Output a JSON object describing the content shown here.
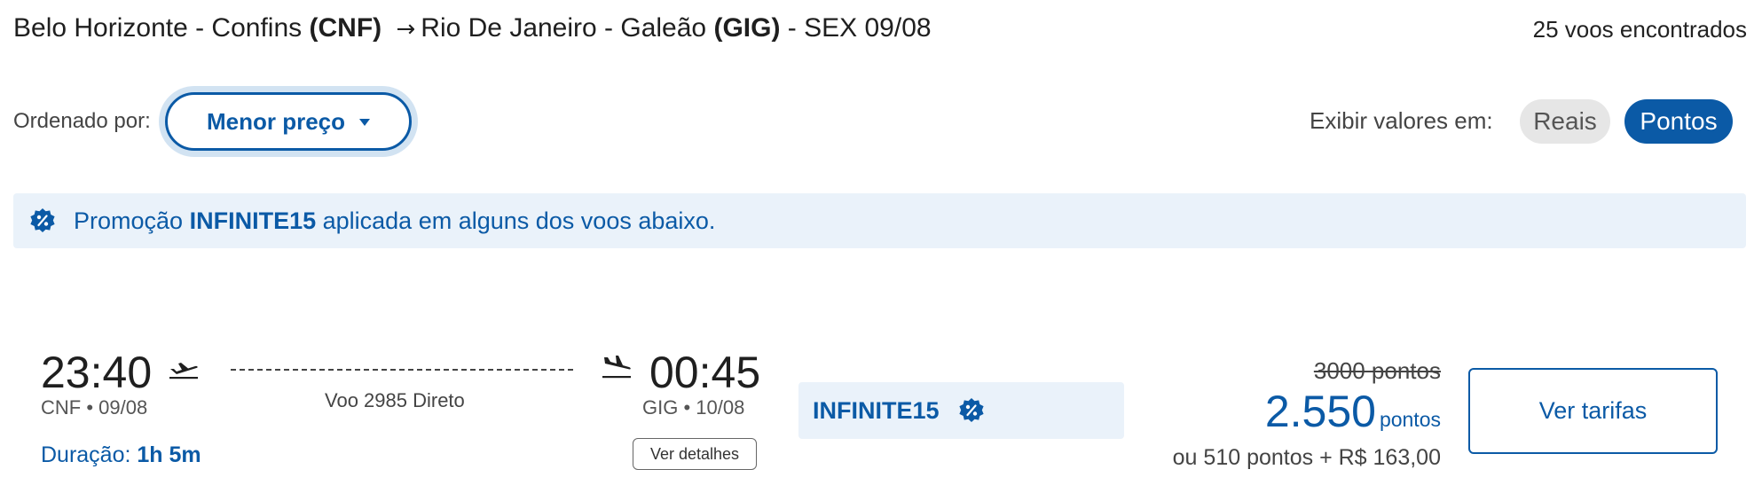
{
  "header": {
    "origin_city": "Belo Horizonte - Confins",
    "origin_code": "(CNF)",
    "arrow": "→",
    "destination_city": "Rio De Janeiro - Galeão",
    "destination_code": "(GIG)",
    "date": "- SEX 09/08",
    "results_count": "25 voos encontrados"
  },
  "sort": {
    "label": "Ordenado por:",
    "selected": "Menor preço"
  },
  "currency_toggle": {
    "label": "Exibir valores em:",
    "options": [
      "Reais",
      "Pontos"
    ],
    "active": "Pontos"
  },
  "promo_banner": {
    "prefix": "Promoção",
    "code": "INFINITE15",
    "suffix": "aplicada em alguns dos voos abaixo."
  },
  "flight": {
    "departure_time": "23:40",
    "departure_info": "CNF • 09/08",
    "arrival_time": "00:45",
    "arrival_info": "GIG • 10/08",
    "flight_info": "Voo 2985 Direto",
    "duration_label": "Duração:",
    "duration_value": "1h 5m",
    "details_button": "Ver detalhes",
    "promo_code": "INFINITE15",
    "old_price": "3000 pontos",
    "price_value": "2.550",
    "price_unit": "pontos",
    "alt_price": "ou 510 pontos + R$ 163,00",
    "fares_button": "Ver tarifas"
  },
  "colors": {
    "brand_blue": "#0b5aa6",
    "promo_bg": "#eaf2fa",
    "inactive_pill": "#e6e6e6"
  }
}
